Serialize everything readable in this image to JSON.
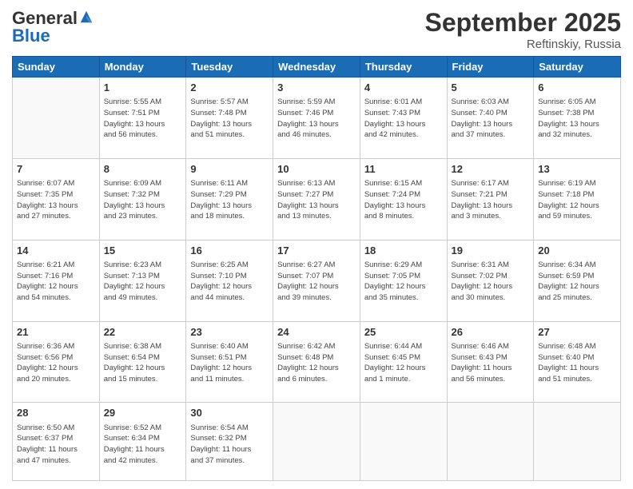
{
  "header": {
    "logo_line1": "General",
    "logo_line2": "Blue",
    "month": "September 2025",
    "location": "Reftinskiy, Russia"
  },
  "weekdays": [
    "Sunday",
    "Monday",
    "Tuesday",
    "Wednesday",
    "Thursday",
    "Friday",
    "Saturday"
  ],
  "weeks": [
    [
      {
        "day": "",
        "info": ""
      },
      {
        "day": "1",
        "info": "Sunrise: 5:55 AM\nSunset: 7:51 PM\nDaylight: 13 hours\nand 56 minutes."
      },
      {
        "day": "2",
        "info": "Sunrise: 5:57 AM\nSunset: 7:48 PM\nDaylight: 13 hours\nand 51 minutes."
      },
      {
        "day": "3",
        "info": "Sunrise: 5:59 AM\nSunset: 7:46 PM\nDaylight: 13 hours\nand 46 minutes."
      },
      {
        "day": "4",
        "info": "Sunrise: 6:01 AM\nSunset: 7:43 PM\nDaylight: 13 hours\nand 42 minutes."
      },
      {
        "day": "5",
        "info": "Sunrise: 6:03 AM\nSunset: 7:40 PM\nDaylight: 13 hours\nand 37 minutes."
      },
      {
        "day": "6",
        "info": "Sunrise: 6:05 AM\nSunset: 7:38 PM\nDaylight: 13 hours\nand 32 minutes."
      }
    ],
    [
      {
        "day": "7",
        "info": "Sunrise: 6:07 AM\nSunset: 7:35 PM\nDaylight: 13 hours\nand 27 minutes."
      },
      {
        "day": "8",
        "info": "Sunrise: 6:09 AM\nSunset: 7:32 PM\nDaylight: 13 hours\nand 23 minutes."
      },
      {
        "day": "9",
        "info": "Sunrise: 6:11 AM\nSunset: 7:29 PM\nDaylight: 13 hours\nand 18 minutes."
      },
      {
        "day": "10",
        "info": "Sunrise: 6:13 AM\nSunset: 7:27 PM\nDaylight: 13 hours\nand 13 minutes."
      },
      {
        "day": "11",
        "info": "Sunrise: 6:15 AM\nSunset: 7:24 PM\nDaylight: 13 hours\nand 8 minutes."
      },
      {
        "day": "12",
        "info": "Sunrise: 6:17 AM\nSunset: 7:21 PM\nDaylight: 13 hours\nand 3 minutes."
      },
      {
        "day": "13",
        "info": "Sunrise: 6:19 AM\nSunset: 7:18 PM\nDaylight: 12 hours\nand 59 minutes."
      }
    ],
    [
      {
        "day": "14",
        "info": "Sunrise: 6:21 AM\nSunset: 7:16 PM\nDaylight: 12 hours\nand 54 minutes."
      },
      {
        "day": "15",
        "info": "Sunrise: 6:23 AM\nSunset: 7:13 PM\nDaylight: 12 hours\nand 49 minutes."
      },
      {
        "day": "16",
        "info": "Sunrise: 6:25 AM\nSunset: 7:10 PM\nDaylight: 12 hours\nand 44 minutes."
      },
      {
        "day": "17",
        "info": "Sunrise: 6:27 AM\nSunset: 7:07 PM\nDaylight: 12 hours\nand 39 minutes."
      },
      {
        "day": "18",
        "info": "Sunrise: 6:29 AM\nSunset: 7:05 PM\nDaylight: 12 hours\nand 35 minutes."
      },
      {
        "day": "19",
        "info": "Sunrise: 6:31 AM\nSunset: 7:02 PM\nDaylight: 12 hours\nand 30 minutes."
      },
      {
        "day": "20",
        "info": "Sunrise: 6:34 AM\nSunset: 6:59 PM\nDaylight: 12 hours\nand 25 minutes."
      }
    ],
    [
      {
        "day": "21",
        "info": "Sunrise: 6:36 AM\nSunset: 6:56 PM\nDaylight: 12 hours\nand 20 minutes."
      },
      {
        "day": "22",
        "info": "Sunrise: 6:38 AM\nSunset: 6:54 PM\nDaylight: 12 hours\nand 15 minutes."
      },
      {
        "day": "23",
        "info": "Sunrise: 6:40 AM\nSunset: 6:51 PM\nDaylight: 12 hours\nand 11 minutes."
      },
      {
        "day": "24",
        "info": "Sunrise: 6:42 AM\nSunset: 6:48 PM\nDaylight: 12 hours\nand 6 minutes."
      },
      {
        "day": "25",
        "info": "Sunrise: 6:44 AM\nSunset: 6:45 PM\nDaylight: 12 hours\nand 1 minute."
      },
      {
        "day": "26",
        "info": "Sunrise: 6:46 AM\nSunset: 6:43 PM\nDaylight: 11 hours\nand 56 minutes."
      },
      {
        "day": "27",
        "info": "Sunrise: 6:48 AM\nSunset: 6:40 PM\nDaylight: 11 hours\nand 51 minutes."
      }
    ],
    [
      {
        "day": "28",
        "info": "Sunrise: 6:50 AM\nSunset: 6:37 PM\nDaylight: 11 hours\nand 47 minutes."
      },
      {
        "day": "29",
        "info": "Sunrise: 6:52 AM\nSunset: 6:34 PM\nDaylight: 11 hours\nand 42 minutes."
      },
      {
        "day": "30",
        "info": "Sunrise: 6:54 AM\nSunset: 6:32 PM\nDaylight: 11 hours\nand 37 minutes."
      },
      {
        "day": "",
        "info": ""
      },
      {
        "day": "",
        "info": ""
      },
      {
        "day": "",
        "info": ""
      },
      {
        "day": "",
        "info": ""
      }
    ]
  ]
}
